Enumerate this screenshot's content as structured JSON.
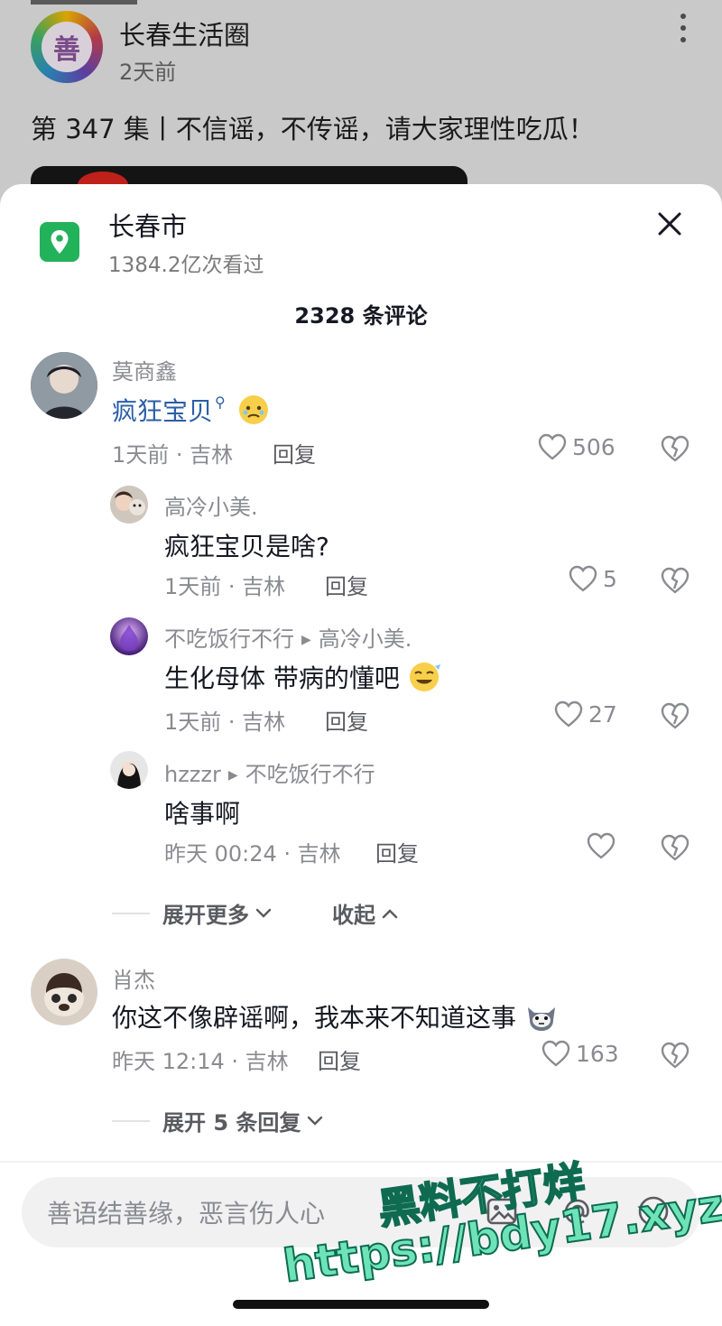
{
  "background_post": {
    "author": "长春生活圈",
    "time": "2天前",
    "avatar_text": "善",
    "caption": "第 347 集丨不信谣，不传谣，请大家理性吃瓜！"
  },
  "location": {
    "title": "长春市",
    "views": "1384.2亿次看过"
  },
  "comments_count_title": "2328 条评论",
  "comments": [
    {
      "name": "莫商鑫",
      "text": "疯狂宝贝",
      "time_loc": "1天前 · 吉林",
      "reply": "回复",
      "likes": "506"
    },
    {
      "name": "高冷小美.",
      "text": "疯狂宝贝是啥?",
      "time_loc": "1天前 · 吉林",
      "reply": "回复",
      "likes": "5"
    },
    {
      "name": "不吃饭行不行",
      "reply_to": "高冷小美.",
      "text": "生化母体 带病的懂吧",
      "time_loc": "1天前 · 吉林",
      "reply": "回复",
      "likes": "27"
    },
    {
      "name": "hzzzr",
      "reply_to": "不吃饭行不行",
      "text": "啥事啊",
      "time_loc": "昨天 00:24 · 吉林",
      "reply": "回复",
      "likes": ""
    },
    {
      "name": "肖杰",
      "text": "你这不像辟谣啊，我本来不知道这事",
      "time_loc": "昨天 12:14 · 吉林",
      "reply": "回复",
      "likes": "163"
    }
  ],
  "expand_more": "展开更多",
  "collapse": "收起",
  "expand_replies": "展开 5 条回复",
  "input": {
    "placeholder": "善语结善缘，恶言伤人心"
  },
  "watermark": {
    "line1": "黑料不打烊",
    "line2": "https://bdy17.xyz"
  },
  "colors": {
    "accent_link": "#2b5ea7",
    "location_icon": "#22b25a",
    "muted_text": "#8a8b91"
  }
}
